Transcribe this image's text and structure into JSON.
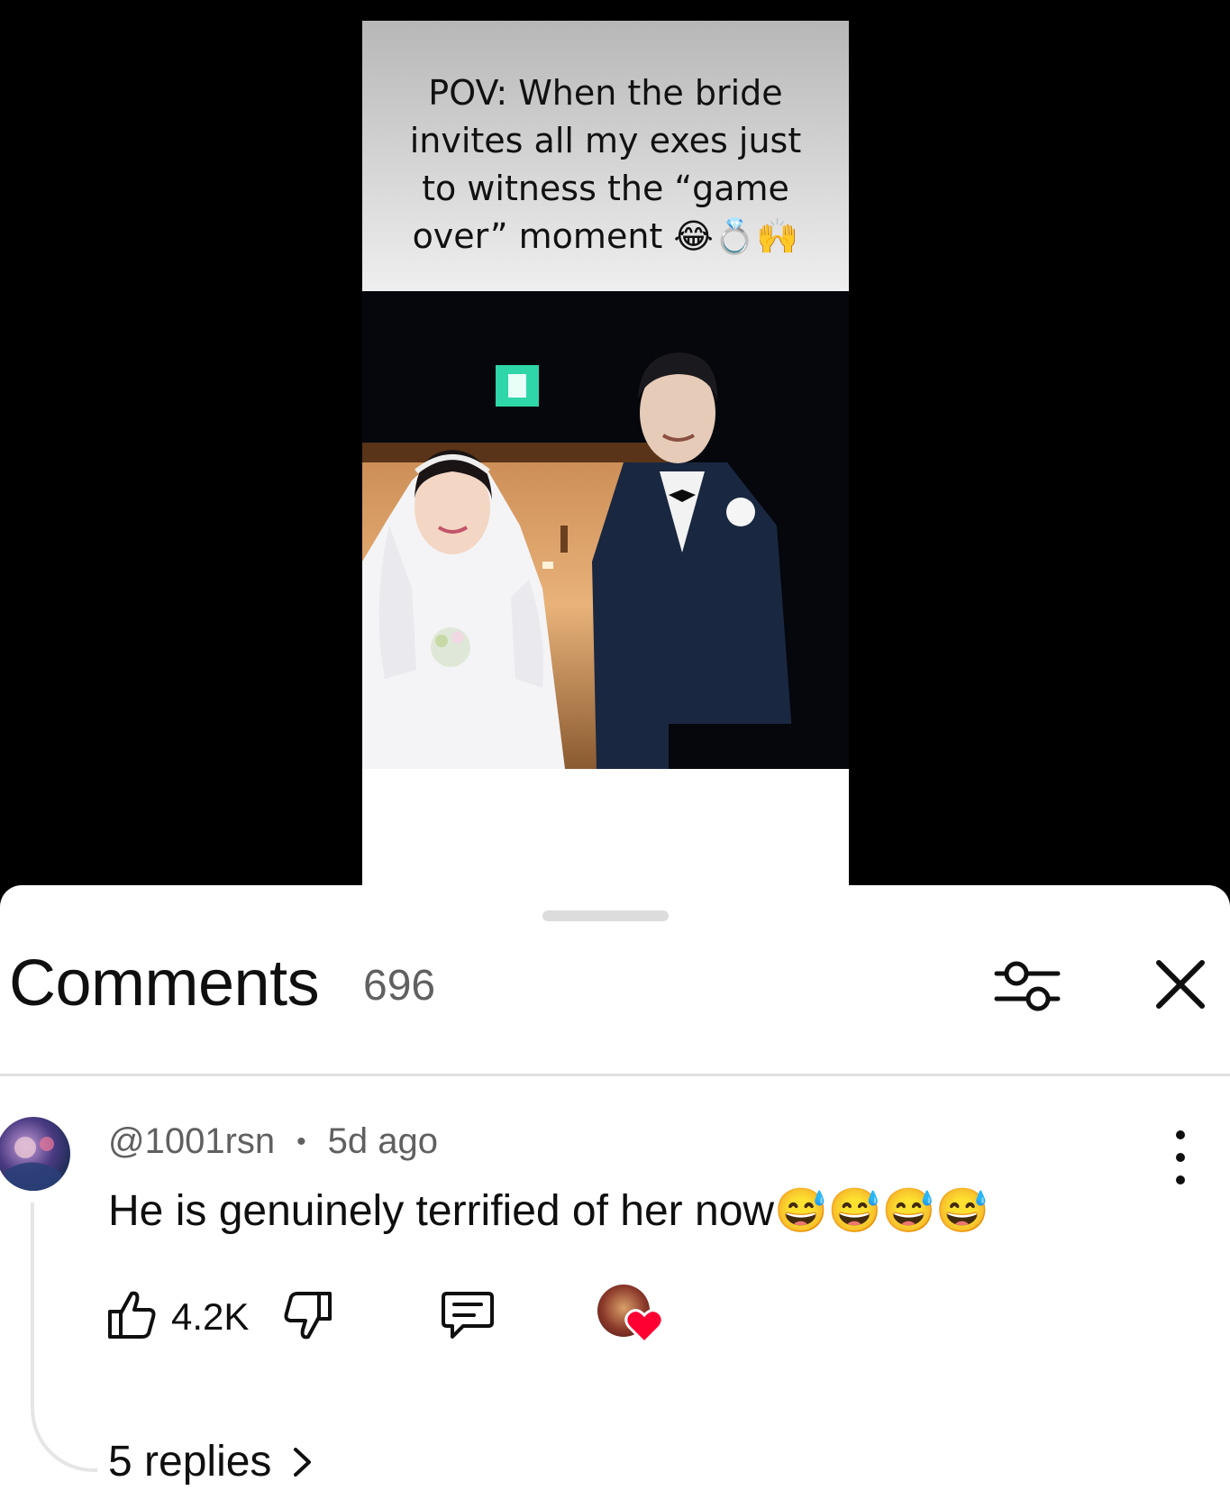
{
  "video": {
    "caption": "POV: When the bride invites all my exes just to witness the “game over” moment 😂💍🙌"
  },
  "comments_panel": {
    "title": "Comments",
    "count": "696",
    "filter_icon": "sliders-icon",
    "close_icon": "close-icon"
  },
  "comment": {
    "author": "@1001rsn",
    "separator": "•",
    "time": "5d ago",
    "text": "He is genuinely terrified of her now😅😅😅😅",
    "likes": "4.2K",
    "replies_label": "5 replies",
    "creator_heart_color": "#ff0033"
  }
}
